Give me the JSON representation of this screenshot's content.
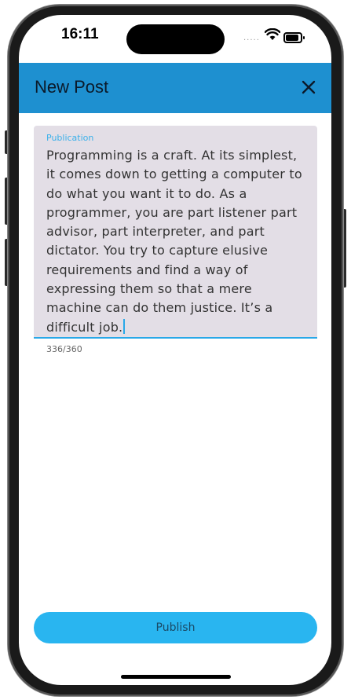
{
  "status_bar": {
    "time": "16:11",
    "signal": "....."
  },
  "app_bar": {
    "title": "New Post"
  },
  "editor": {
    "label": "Publication",
    "text": "Programming is a craft. At its simplest, it comes down to getting a computer to do what you want it to do. As a programmer, you are part listener part advisor, part interpreter, and part dictator. You try to capture elusive requirements and find a way of expressing them so that a mere machine can do them justice. It’s a difficult job.",
    "counter": "336/360"
  },
  "actions": {
    "publish_label": "Publish"
  },
  "colors": {
    "accent": "#1e90d0",
    "button": "#29b5f0",
    "field": "#e3dee6"
  }
}
